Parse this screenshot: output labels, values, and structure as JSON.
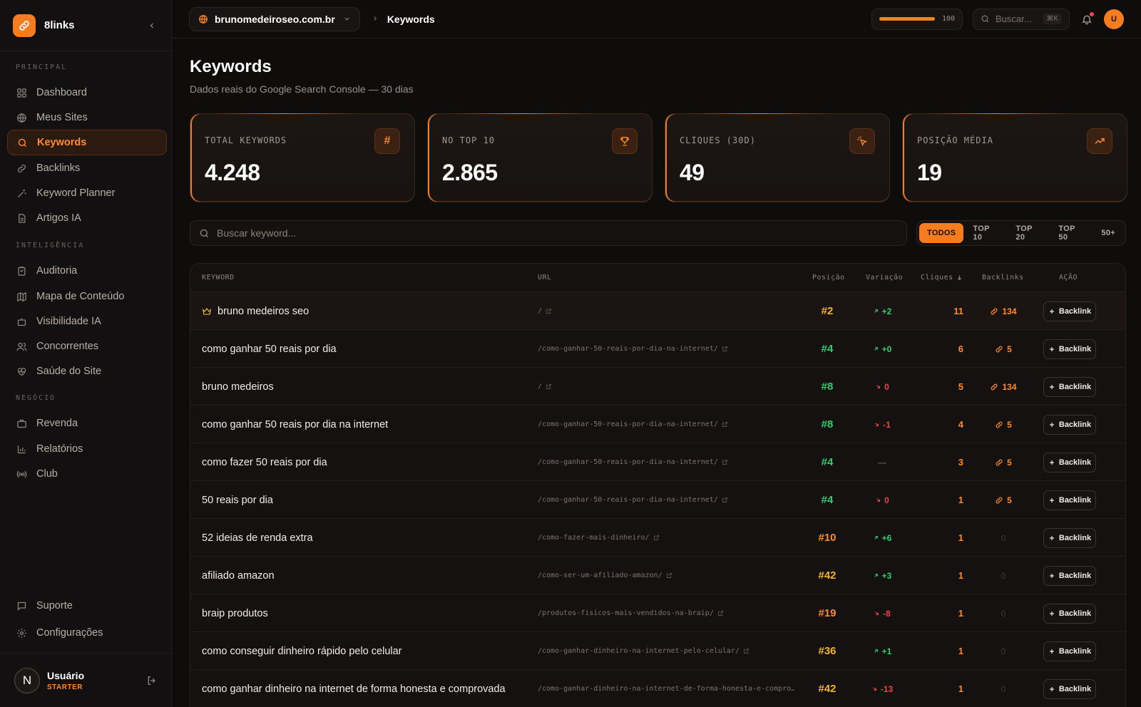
{
  "app": {
    "name": "8links"
  },
  "sidebar": {
    "sections": [
      {
        "title": "PRINCIPAL"
      },
      {
        "title": "INTELIGÊNCIA"
      },
      {
        "title": "NEGÓCIO"
      }
    ],
    "items": [
      {
        "label": "Dashboard",
        "icon": "grid-icon"
      },
      {
        "label": "Meus Sites",
        "icon": "globe-icon"
      },
      {
        "label": "Keywords",
        "icon": "search-icon",
        "active": true
      },
      {
        "label": "Backlinks",
        "icon": "link-icon"
      },
      {
        "label": "Keyword Planner",
        "icon": "wand-icon"
      },
      {
        "label": "Artigos IA",
        "icon": "document-icon"
      },
      {
        "label": "Auditoria",
        "icon": "clipboard-icon"
      },
      {
        "label": "Mapa de Conteúdo",
        "icon": "map-icon"
      },
      {
        "label": "Visibilidade IA",
        "icon": "bot-icon"
      },
      {
        "label": "Concorrentes",
        "icon": "users-icon"
      },
      {
        "label": "Saúde do Site",
        "icon": "heart-pulse-icon"
      },
      {
        "label": "Revenda",
        "icon": "briefcase-icon"
      },
      {
        "label": "Relatórios",
        "icon": "bar-chart-icon"
      },
      {
        "label": "Club",
        "icon": "radio-icon"
      },
      {
        "label": "Suporte",
        "icon": "message-icon"
      },
      {
        "label": "Configurações",
        "icon": "gear-icon"
      }
    ],
    "user": {
      "initial": "N",
      "name": "Usuário",
      "plan": "STARTER"
    }
  },
  "topbar": {
    "site": "brunomedeiroseo.com.br",
    "breadcrumb": "Keywords",
    "credits": {
      "value": "100",
      "fill_percent": 100
    },
    "search_placeholder": "Buscar...",
    "shortcut": "⌘K",
    "avatar_initial": "U"
  },
  "page": {
    "title": "Keywords",
    "subtitle": "Dados reais do Google Search Console — 30 dias"
  },
  "stats": [
    {
      "label": "TOTAL KEYWORDS",
      "value": "4.248",
      "icon": "hash-icon"
    },
    {
      "label": "NO TOP 10",
      "value": "2.865",
      "icon": "trophy-icon"
    },
    {
      "label": "CLIQUES (30D)",
      "value": "49",
      "icon": "click-icon"
    },
    {
      "label": "POSIÇÃO MÉDIA",
      "value": "19",
      "icon": "trending-up-icon"
    }
  ],
  "search": {
    "placeholder": "Buscar keyword..."
  },
  "filters": [
    "TODOS",
    "TOP 10",
    "TOP 20",
    "TOP 50",
    "50+"
  ],
  "table": {
    "headers": {
      "keyword": "KEYWORD",
      "url": "URL",
      "position": "Posição",
      "variation": "Variação",
      "clicks": "Cliques",
      "backlinks": "Backlinks",
      "action": "AÇÃO"
    },
    "action_label": "Backlink",
    "rows": [
      {
        "keyword": "bruno medeiros seo",
        "url": "/",
        "position": "#2",
        "pos_color": "yellow",
        "variation": "+2",
        "var_dir": "up",
        "clicks": "11",
        "backlinks": "134",
        "crown": true
      },
      {
        "keyword": "como ganhar 50 reais por dia",
        "url": "/como-ganhar-50-reais-por-dia-na-internet/",
        "position": "#4",
        "pos_color": "green",
        "variation": "+0",
        "var_dir": "up",
        "clicks": "6",
        "backlinks": "5"
      },
      {
        "keyword": "bruno medeiros",
        "url": "/",
        "position": "#8",
        "pos_color": "green",
        "variation": "0",
        "var_dir": "down",
        "clicks": "5",
        "backlinks": "134"
      },
      {
        "keyword": "como ganhar 50 reais por dia na internet",
        "url": "/como-ganhar-50-reais-por-dia-na-internet/",
        "position": "#8",
        "pos_color": "green",
        "variation": "-1",
        "var_dir": "down",
        "clicks": "4",
        "backlinks": "5"
      },
      {
        "keyword": "como fazer 50 reais por dia",
        "url": "/como-ganhar-50-reais-por-dia-na-internet/",
        "position": "#4",
        "pos_color": "green",
        "variation": "—",
        "var_dir": "flat",
        "clicks": "3",
        "backlinks": "5"
      },
      {
        "keyword": "50 reais por dia",
        "url": "/como-ganhar-50-reais-por-dia-na-internet/",
        "position": "#4",
        "pos_color": "green",
        "variation": "0",
        "var_dir": "down",
        "clicks": "1",
        "backlinks": "5"
      },
      {
        "keyword": "52 ideias de renda extra",
        "url": "/como-fazer-mais-dinheiro/",
        "position": "#10",
        "pos_color": "orange",
        "variation": "+6",
        "var_dir": "up",
        "clicks": "1",
        "backlinks": "0"
      },
      {
        "keyword": "afiliado amazon",
        "url": "/como-ser-um-afiliado-amazon/",
        "position": "#42",
        "pos_color": "yellow",
        "variation": "+3",
        "var_dir": "up",
        "clicks": "1",
        "backlinks": "0"
      },
      {
        "keyword": "braip produtos",
        "url": "/produtos-fisicos-mais-vendidos-na-braip/",
        "position": "#19",
        "pos_color": "orange",
        "variation": "-8",
        "var_dir": "down",
        "clicks": "1",
        "backlinks": "0"
      },
      {
        "keyword": "como conseguir dinheiro rápido pelo celular",
        "url": "/como-ganhar-dinheiro-na-internet-pelo-celular/",
        "position": "#36",
        "pos_color": "yellow",
        "variation": "+1",
        "var_dir": "up",
        "clicks": "1",
        "backlinks": "0"
      },
      {
        "keyword": "como ganhar dinheiro na internet de forma honesta e comprovada",
        "url": "/como-ganhar-dinheiro-na-internet-de-forma-honesta-e-compro…",
        "position": "#42",
        "pos_color": "yellow",
        "variation": "-13",
        "var_dir": "down",
        "clicks": "1",
        "backlinks": "0"
      }
    ]
  }
}
